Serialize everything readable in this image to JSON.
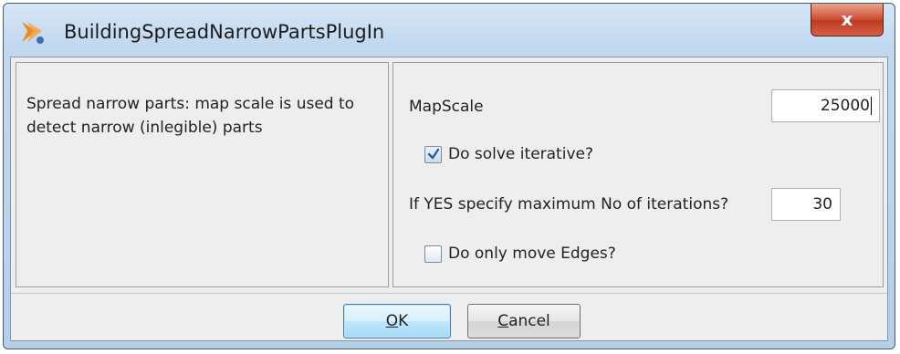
{
  "window": {
    "title": "BuildingSpreadNarrowPartsPlugIn",
    "close_label": "x",
    "icons": {
      "app": "plugin-logo-icon",
      "close": "close-icon"
    }
  },
  "description": "Spread narrow parts: map scale is used to detect narrow (inlegible) parts",
  "form": {
    "mapscale_label": "MapScale",
    "mapscale_value": "25000",
    "iterative_label": "Do solve iterative?",
    "iterative_checked": true,
    "iterations_label": "If YES specify maximum No of iterations?",
    "iterations_value": "30",
    "edges_label": "Do only move Edges?",
    "edges_checked": false
  },
  "buttons": {
    "ok_mnemonic": "O",
    "ok_rest": "K",
    "cancel_mnemonic": "C",
    "cancel_rest": "ancel"
  },
  "colors": {
    "titlebar": "#c2d8ef",
    "close_button": "#c03a22",
    "panel_bg": "#eeeeee",
    "checkmark": "#2b5b9a"
  }
}
